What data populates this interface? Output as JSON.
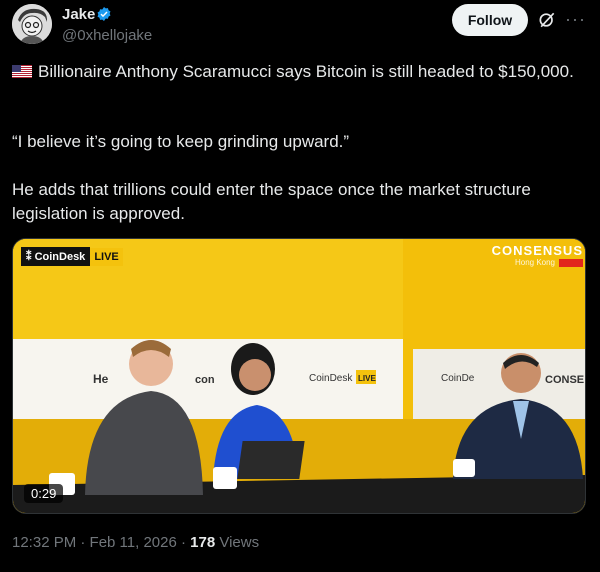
{
  "author": {
    "name": "Jake",
    "handle": "@0xhellojake"
  },
  "actions": {
    "follow_label": "Follow",
    "more_label": "···"
  },
  "tweet": {
    "line1": "Billionaire Anthony Scaramucci says Bitcoin is still headed to $150,000.",
    "line2": "“I believe it’s going to keep grinding upward.”",
    "line3": "He adds that trillions could enter the space once the market structure legislation is approved."
  },
  "video": {
    "duration": "0:29",
    "coindesk_label": "CoinDesk",
    "live_label": "LIVE",
    "consensus_label": "CONSENSUS",
    "consensus_sub": "Hong Kong"
  },
  "meta": {
    "time_date": "12:32 PM · Feb 11, 2026 · ",
    "views_count": "178",
    "views_label": " Views"
  },
  "colors": {
    "background": "#000000",
    "text": "#e7e9ea",
    "muted": "#71767b",
    "verified_blue": "#1d9bf0",
    "studio_yellow": "#f4c20d"
  }
}
